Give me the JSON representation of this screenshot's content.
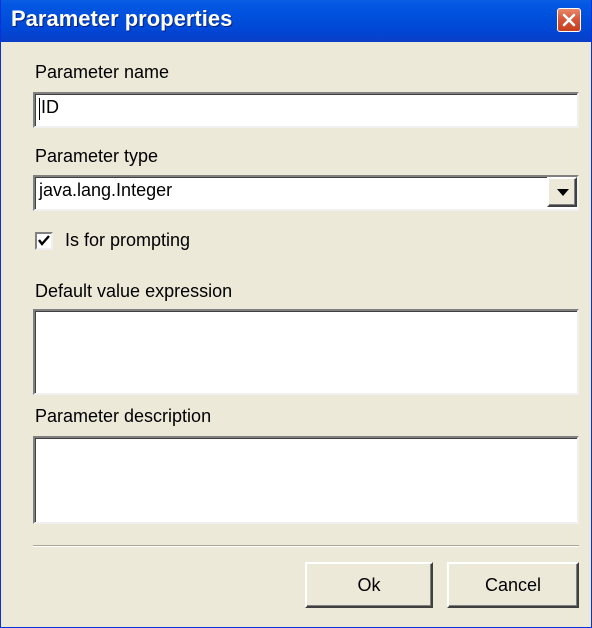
{
  "window": {
    "title": "Parameter properties"
  },
  "form": {
    "name_label": "Parameter name",
    "name_value": "ID",
    "type_label": "Parameter type",
    "type_value": "java.lang.Integer",
    "prompt_label": "Is for prompting",
    "prompt_checked": true,
    "default_label": "Default value expression",
    "default_value": "",
    "description_label": "Parameter description",
    "description_value": ""
  },
  "buttons": {
    "ok_label": "Ok",
    "cancel_label": "Cancel"
  },
  "icons": {
    "close": "close-icon",
    "dropdown": "chevron-down-icon",
    "check": "checkmark-icon"
  },
  "colors": {
    "titlebar": "#0050dc",
    "dialog_background": "#ece9d8",
    "close_button": "#d9573a"
  }
}
